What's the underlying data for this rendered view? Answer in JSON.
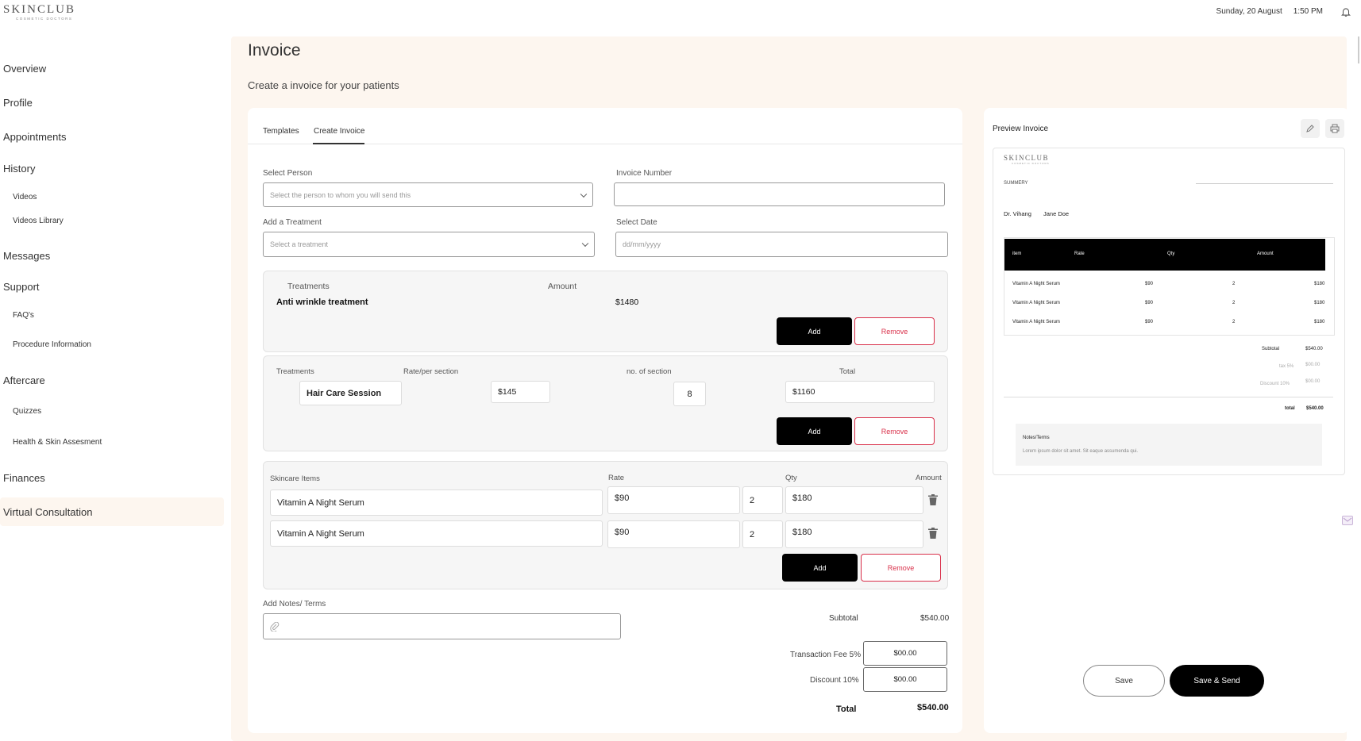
{
  "brand": {
    "name": "SKINCLUB",
    "tagline": "COSMETIC DOCTORS"
  },
  "header": {
    "date": "Sunday, 20 August",
    "time": "1:50 PM",
    "bell_icon": "bell-icon"
  },
  "sidebar": {
    "items": [
      {
        "label": "Overview"
      },
      {
        "label": "Profile"
      },
      {
        "label": "Appointments"
      },
      {
        "label": "History"
      },
      {
        "label": "Videos"
      },
      {
        "label": "Videos Library"
      },
      {
        "label": "Messages"
      },
      {
        "label": "Support"
      },
      {
        "label": "FAQ's"
      },
      {
        "label": "Procedure Information"
      },
      {
        "label": "Aftercare"
      },
      {
        "label": "Quizzes"
      },
      {
        "label": "Health & Skin Assesment"
      },
      {
        "label": "Finances"
      },
      {
        "label": "Virtual Consultation"
      }
    ]
  },
  "page": {
    "title": "Invoice",
    "subtitle": "Create a invoice for your patients"
  },
  "tabs": [
    {
      "label": "Templates"
    },
    {
      "label": "Create Invoice"
    }
  ],
  "form": {
    "select_person_label": "Select Person",
    "select_person_placeholder": "Select the person to whom you will send this",
    "invoice_number_label": "Invoice Number",
    "invoice_number_value": "",
    "treatment_label": "Add a Treatment",
    "treatment_placeholder": "Select a treatment",
    "date_label": "Select Date",
    "date_placeholder": "dd/mm/yyyy"
  },
  "treatment_block": {
    "col_treatments": "Treatments",
    "col_amount": "Amount",
    "name": "Anti wrinkle treatment",
    "amount": "$1480",
    "add": "Add",
    "remove": "Remove"
  },
  "session_block": {
    "col_treatments": "Treatments",
    "col_rate": "Rate/per section",
    "col_sections": "no. of section",
    "col_total": "Total",
    "name": "Hair Care Session",
    "rate": "$145",
    "sections": "8",
    "total": "$1160",
    "add": "Add",
    "remove": "Remove"
  },
  "skincare_block": {
    "col_items": "Skincare Items",
    "col_rate": "Rate",
    "col_qty": "Qty",
    "col_amount": "Amount",
    "rows": [
      {
        "item": "Vitamin A Night Serum",
        "rate": "$90",
        "qty": "2",
        "amount": "$180"
      },
      {
        "item": "Vitamin A Night Serum",
        "rate": "$90",
        "qty": "2",
        "amount": "$180"
      }
    ],
    "add": "Add",
    "remove": "Remove"
  },
  "notes": {
    "label": "Add Notes/ Terms",
    "value": ""
  },
  "totals": {
    "subtotal_label": "Subtotal",
    "subtotal": "$540.00",
    "fee_label": "Transaction Fee 5%",
    "fee": "$00.00",
    "discount_label": "Discount 10%",
    "discount": "$00.00",
    "total_label": "Total",
    "total": "$540.00"
  },
  "preview": {
    "title": "Preview Invoice",
    "summary_label": "SUMMERY",
    "doctor": "Dr. Vihang",
    "patient": "Jane Doe",
    "table_headers": {
      "item": "item",
      "rate": "Rate",
      "qty": "Qty",
      "amount": "Amount"
    },
    "rows": [
      {
        "item": "Vitamin A Night Serum",
        "rate": "$90",
        "qty": "2",
        "amount": "$180"
      },
      {
        "item": "Vitamin A Night Serum",
        "rate": "$90",
        "qty": "2",
        "amount": "$180"
      },
      {
        "item": "Vitamin A Night Serum",
        "rate": "$90",
        "qty": "2",
        "amount": "$180"
      }
    ],
    "subtotal_label": "Subtotal",
    "subtotal": "$540.00",
    "tax_label": "tax 5%",
    "tax": "$00.00",
    "discount_label": "Discount 10%",
    "discount": "$00.00",
    "total_label": "total",
    "total": "$540.00",
    "notes_title": "Notes/Terms",
    "notes_text": "Lorem ipsum dolor sit amet. Sit eaque assumenda qui."
  },
  "actions": {
    "save": "Save",
    "save_send": "Save & Send"
  }
}
